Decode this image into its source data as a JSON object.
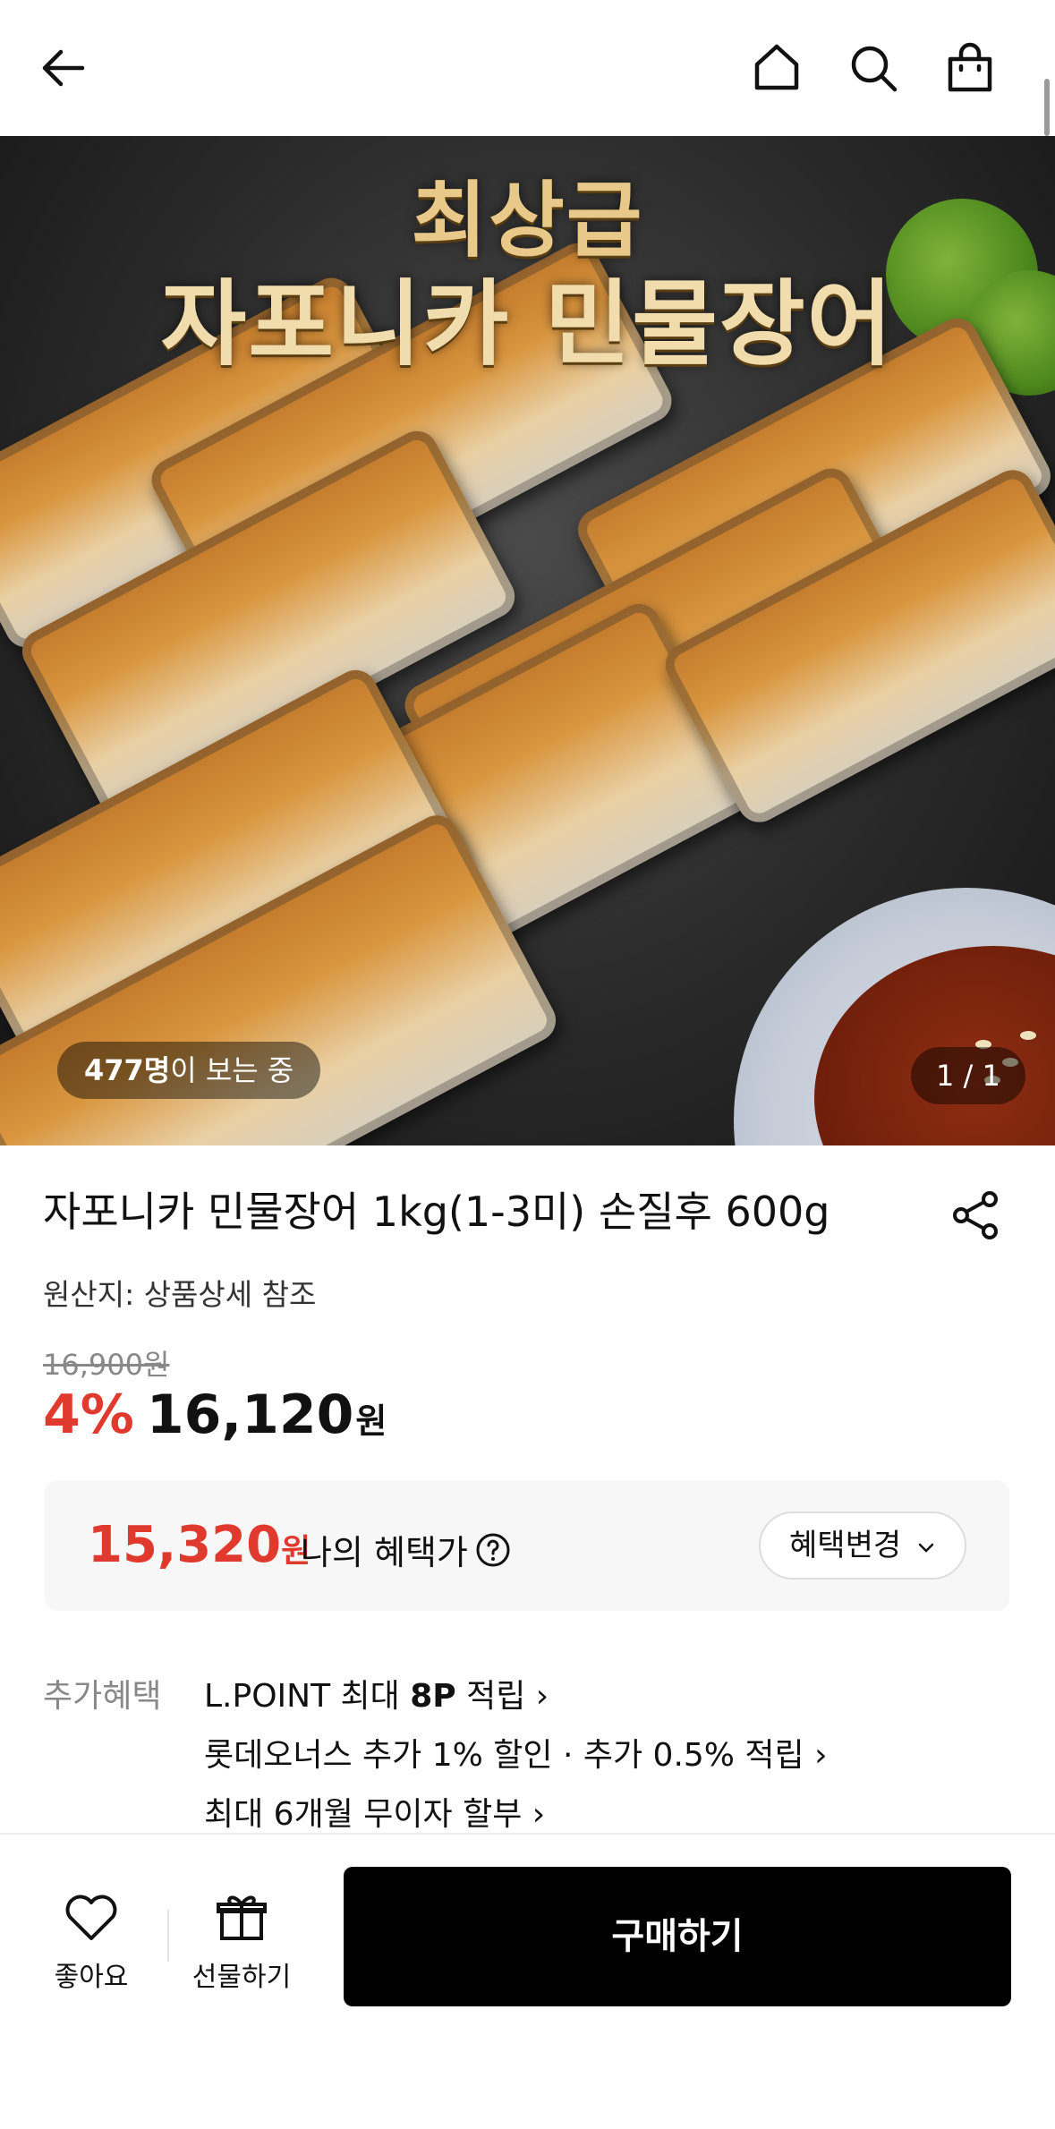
{
  "header": {
    "back_icon": "arrow-left-icon",
    "home_icon": "home-icon",
    "search_icon": "search-icon",
    "bag_icon": "shopping-bag-icon"
  },
  "hero": {
    "headline_line1": "최상급",
    "headline_line2": "자포니카 민물장어",
    "viewers_count": "477명",
    "viewers_suffix": "이 보는 중",
    "pager": "1 / 1"
  },
  "product": {
    "title": "자포니카 민물장어 1kg(1-3미) 손질후 600g",
    "origin": "원산지: 상품상세 참조",
    "original_price": "16,900원",
    "discount_rate": "4%",
    "price": "16,120",
    "price_unit": "원",
    "share_icon": "share-icon"
  },
  "benefit": {
    "price": "15,320",
    "price_unit": "원",
    "label": "나의 혜택가",
    "help_icon": "question-circle-icon",
    "change_button": "혜택변경"
  },
  "extra_benefits": {
    "label": "추가혜택",
    "item1_prefix": "L.POINT 최대 ",
    "item1_bold": "8P",
    "item1_suffix": " 적립 ›",
    "item2": "롯데오너스 추가 1% 할인 · 추가 0.5% 적립 ›",
    "item3": "최대 6개월 무이자 할부 ›"
  },
  "bottom_bar": {
    "like_label": "좋아요",
    "gift_label": "선물하기",
    "buy_label": "구매하기"
  },
  "colors": {
    "accent_red": "#e03a2f",
    "buy_button": "#000000"
  }
}
